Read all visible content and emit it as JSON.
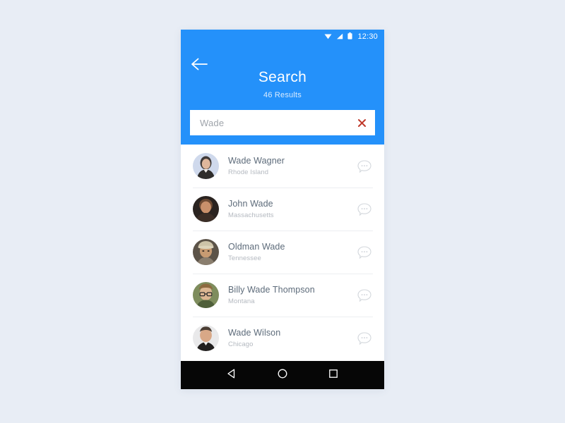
{
  "theme": {
    "accent": "#2491fa",
    "page_background": "#e8edf5",
    "card_background": "#ffffff",
    "clear_icon_color": "#c0392b",
    "navbar_background": "#060606",
    "name_color": "#5d6b7a",
    "sub_color": "#b4b9c0"
  },
  "statusbar": {
    "time": "12:30",
    "icons": [
      "wifi-icon",
      "signal-icon",
      "battery-icon"
    ]
  },
  "header": {
    "back_icon": "back-arrow-icon",
    "title": "Search",
    "subtitle": "46 Results"
  },
  "search": {
    "value": "Wade",
    "placeholder": "Search",
    "clear_icon": "clear-x-icon"
  },
  "results": {
    "action_icon": "chat-bubble-icon",
    "items": [
      {
        "name": "Wade Wagner",
        "location": "Rhode Island",
        "avatar": "avatar-wade-wagner"
      },
      {
        "name": "John Wade",
        "location": "Massachusetts",
        "avatar": "avatar-john-wade"
      },
      {
        "name": "Oldman Wade",
        "location": "Tennessee",
        "avatar": "avatar-oldman-wade"
      },
      {
        "name": "Billy Wade Thompson",
        "location": "Montana",
        "avatar": "avatar-billy-wade-thompson"
      },
      {
        "name": "Wade Wilson",
        "location": "Chicago",
        "avatar": "avatar-wade-wilson"
      }
    ]
  },
  "navbar": {
    "back_label": "Back",
    "home_label": "Home",
    "recents_label": "Recents"
  }
}
